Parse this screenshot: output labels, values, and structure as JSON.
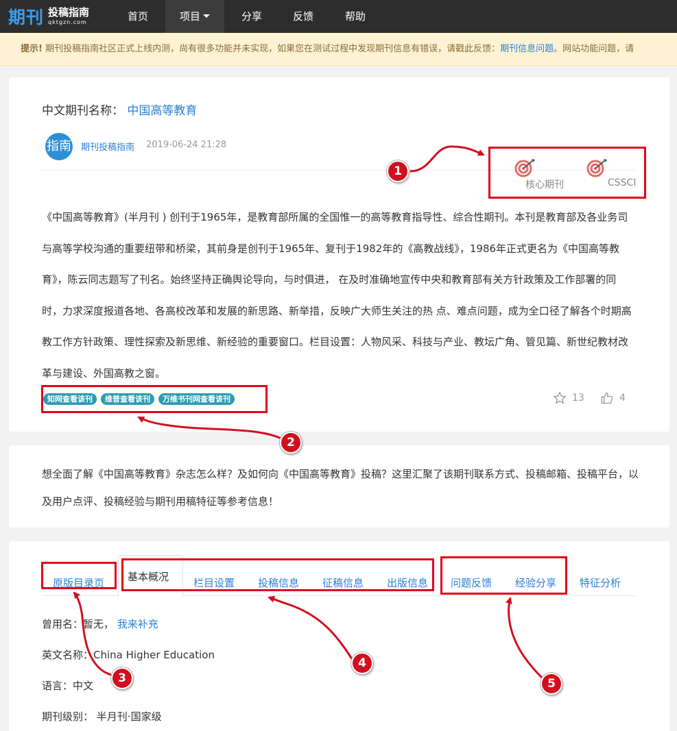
{
  "nav": {
    "logo_big": "期刊",
    "logo_title": "投稿指南",
    "logo_sub": "qktgzn.com",
    "items": [
      {
        "label": "首页"
      },
      {
        "label": "项目"
      },
      {
        "label": "分享"
      },
      {
        "label": "反馈"
      },
      {
        "label": "帮助"
      }
    ]
  },
  "notice": {
    "prefix": "提示!",
    "text": " 期刊投稿指南社区正式上线内测，尚有很多功能并未实现，如果您在测试过程中发现期刊信息有错误，请戳此反馈：",
    "link1": "期刊信息问题",
    "text2": "。网站功能问题，请"
  },
  "journal": {
    "label": "中文期刊名称：",
    "name": "中国高等教育",
    "avatar_text": "指南",
    "author": "期刊投稿指南",
    "time": "2019-06-24 21:28",
    "badges": [
      {
        "label": "核心期刊"
      },
      {
        "label": "CSSCI"
      }
    ],
    "description": "《中国高等教育》(半月刊 ) 创刊于1965年，是教育部所属的全国惟一的高等教育指导性、综合性期刊。本刊是教育部及各业务司与高等学校沟通的重要纽带和桥梁，其前身是创刊于1965年、复刊于1982年的《高教战线》，1986年正式更名为《中国高等教育》，陈云同志题写了刊名。始终坚持正确舆论导向，与时俱进， 在及时准确地宣传中央和教育部有关方针政策及工作部署的同时，力求深度报道各地、各高校改革和发展的新思路、新举措，反映广大师生关注的热 点、难点问题，成为全口径了解各个时期高教工作方针政策、理性探索及新思维、新经验的重要窗口。栏目设置：人物风采、科技与产业、教坛广角、管见篇、新世纪教材改革与建设、外国高教之窗。",
    "tags": [
      {
        "label": "知网查看该刊"
      },
      {
        "label": "维普查看该刊"
      },
      {
        "label": "万维书刊网查看该刊"
      }
    ],
    "stars": "13",
    "likes": "4"
  },
  "intro": {
    "text": "想全面了解《中国高等教育》杂志怎么样？及如何向《中国高等教育》投稿？这里汇聚了该期刊联系方式、投稿邮箱、投稿平台，以及用户点评、投稿经验与期刊用稿特征等参考信息！"
  },
  "tabs": {
    "original": "原版目录页",
    "active": "基本概况",
    "items": [
      {
        "label": "栏目设置"
      },
      {
        "label": "投稿信息"
      },
      {
        "label": "征稿信息"
      },
      {
        "label": "出版信息"
      },
      {
        "label": "问题反馈"
      },
      {
        "label": "经验分享"
      },
      {
        "label": "特征分析"
      }
    ]
  },
  "info": {
    "former_label": "曾用名：暂无，",
    "former_link": "我来补充",
    "english_label": "英文名称：",
    "english_value": "China Higher Education",
    "lang_label": "语言：",
    "lang_value": "中文",
    "level_label": "期刊级别：",
    "level_value": "半月刊·国家级"
  },
  "annotations": [
    "1",
    "2",
    "3",
    "4",
    "5"
  ],
  "colors": {
    "link": "#2980d9",
    "nav_bg": "#2d2d2d",
    "tag_bg": "#2d9bb3",
    "annotation_red": "#e0001b"
  }
}
